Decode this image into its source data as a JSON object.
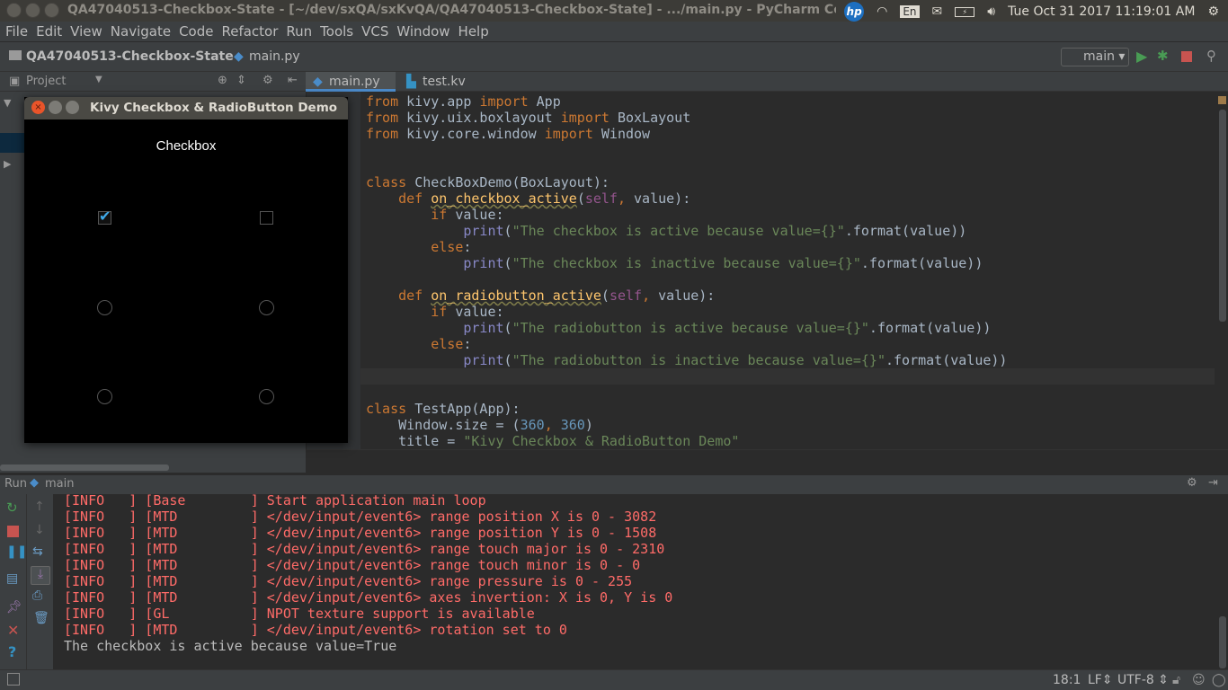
{
  "os": {
    "window_title": "QA47040513-Checkbox-State - [~/dev/sxQA/sxKvQA/QA47040513-Checkbox-State] - .../main.py - PyCharm Community Edition",
    "keyboard": "En",
    "datetime": "Tue Oct 31 2017 11:19:01 AM"
  },
  "menu": [
    "File",
    "Edit",
    "View",
    "Navigate",
    "Code",
    "Refactor",
    "Run",
    "Tools",
    "VCS",
    "Window",
    "Help"
  ],
  "breadcrumb": {
    "project": "QA47040513-Checkbox-State",
    "file": "main.py"
  },
  "run_config": "main",
  "tool_window": {
    "label": "Project"
  },
  "tabs": [
    {
      "label": "main.py",
      "active": true
    },
    {
      "label": "test.kv",
      "active": false
    }
  ],
  "kivy": {
    "title": "Kivy Checkbox & RadioButton Demo",
    "label": "Checkbox",
    "checkboxes": [
      {
        "checked": true
      },
      {
        "checked": false
      }
    ],
    "radios": [
      {
        "checked": false
      },
      {
        "checked": false
      },
      {
        "checked": false
      },
      {
        "checked": false
      }
    ]
  },
  "code": [
    [
      [
        "from ",
        "k"
      ],
      [
        "kivy.app ",
        ""
      ],
      [
        "import ",
        "k"
      ],
      [
        "App",
        ""
      ]
    ],
    [
      [
        "from ",
        "k"
      ],
      [
        "kivy.uix.boxlayout ",
        ""
      ],
      [
        "import ",
        "k"
      ],
      [
        "BoxLayout",
        ""
      ]
    ],
    [
      [
        "from ",
        "k"
      ],
      [
        "kivy.core.window ",
        ""
      ],
      [
        "import ",
        "k"
      ],
      [
        "Window",
        ""
      ]
    ],
    [],
    [],
    [
      [
        "class ",
        "k"
      ],
      [
        "CheckBoxDemo(BoxLayout):",
        ""
      ]
    ],
    [
      [
        "    def ",
        "k"
      ],
      [
        "on_checkbox_active",
        "f"
      ],
      [
        "(",
        ""
      ],
      [
        "self",
        "sf"
      ],
      [
        ", ",
        "k"
      ],
      [
        "value):",
        ""
      ]
    ],
    [
      [
        "        if ",
        "k"
      ],
      [
        "value:",
        ""
      ]
    ],
    [
      [
        "            ",
        ""
      ],
      [
        "print",
        "b"
      ],
      [
        "(",
        ""
      ],
      [
        "\"The checkbox is active because value={}\"",
        "s"
      ],
      [
        ".format(value))",
        ""
      ]
    ],
    [
      [
        "        else",
        "k"
      ],
      [
        ":",
        ""
      ]
    ],
    [
      [
        "            ",
        ""
      ],
      [
        "print",
        "b"
      ],
      [
        "(",
        ""
      ],
      [
        "\"The checkbox is inactive because value={}\"",
        "s"
      ],
      [
        ".format(value))",
        ""
      ]
    ],
    [],
    [
      [
        "    def ",
        "k"
      ],
      [
        "on_radiobutton_active",
        "f"
      ],
      [
        "(",
        ""
      ],
      [
        "self",
        "sf"
      ],
      [
        ", ",
        "k"
      ],
      [
        "value):",
        ""
      ]
    ],
    [
      [
        "        if ",
        "k"
      ],
      [
        "value:",
        ""
      ]
    ],
    [
      [
        "            ",
        ""
      ],
      [
        "print",
        "b"
      ],
      [
        "(",
        ""
      ],
      [
        "\"The radiobutton is active because value={}\"",
        "s"
      ],
      [
        ".format(value))",
        ""
      ]
    ],
    [
      [
        "        else",
        "k"
      ],
      [
        ":",
        ""
      ]
    ],
    [
      [
        "            ",
        ""
      ],
      [
        "print",
        "b"
      ],
      [
        "(",
        ""
      ],
      [
        "\"The radiobutton is inactive because value={}\"",
        "s"
      ],
      [
        ".format(value))",
        ""
      ]
    ],
    [],
    [],
    [
      [
        "class ",
        "k"
      ],
      [
        "TestApp(App):",
        ""
      ]
    ],
    [
      [
        "    Window.size = (",
        ""
      ],
      [
        "360",
        "n"
      ],
      [
        ", ",
        "k"
      ],
      [
        "360",
        "n"
      ],
      [
        ")",
        ""
      ]
    ],
    [
      [
        "    title = ",
        ""
      ],
      [
        "\"Kivy Checkbox & RadioButton Demo\"",
        "s"
      ]
    ]
  ],
  "run": {
    "label": "Run",
    "config": "main"
  },
  "console": [
    "[INFO   ] [Base        ] Start application main loop",
    "[INFO   ] [MTD         ] </dev/input/event6> range position X is 0 - 3082",
    "[INFO   ] [MTD         ] </dev/input/event6> range position Y is 0 - 1508",
    "[INFO   ] [MTD         ] </dev/input/event6> range touch major is 0 - 2310",
    "[INFO   ] [MTD         ] </dev/input/event6> range touch minor is 0 - 0",
    "[INFO   ] [MTD         ] </dev/input/event6> range pressure is 0 - 255",
    "[INFO   ] [MTD         ] </dev/input/event6> axes invertion: X is 0, Y is 0",
    "[INFO   ] [GL          ] NPOT texture support is available",
    "[INFO   ] [MTD         ] </dev/input/event6> rotation set to 0"
  ],
  "console_output": "The checkbox is active because value=True",
  "status": {
    "position": "18:1",
    "line_sep": "LF",
    "encoding": "UTF-8"
  }
}
